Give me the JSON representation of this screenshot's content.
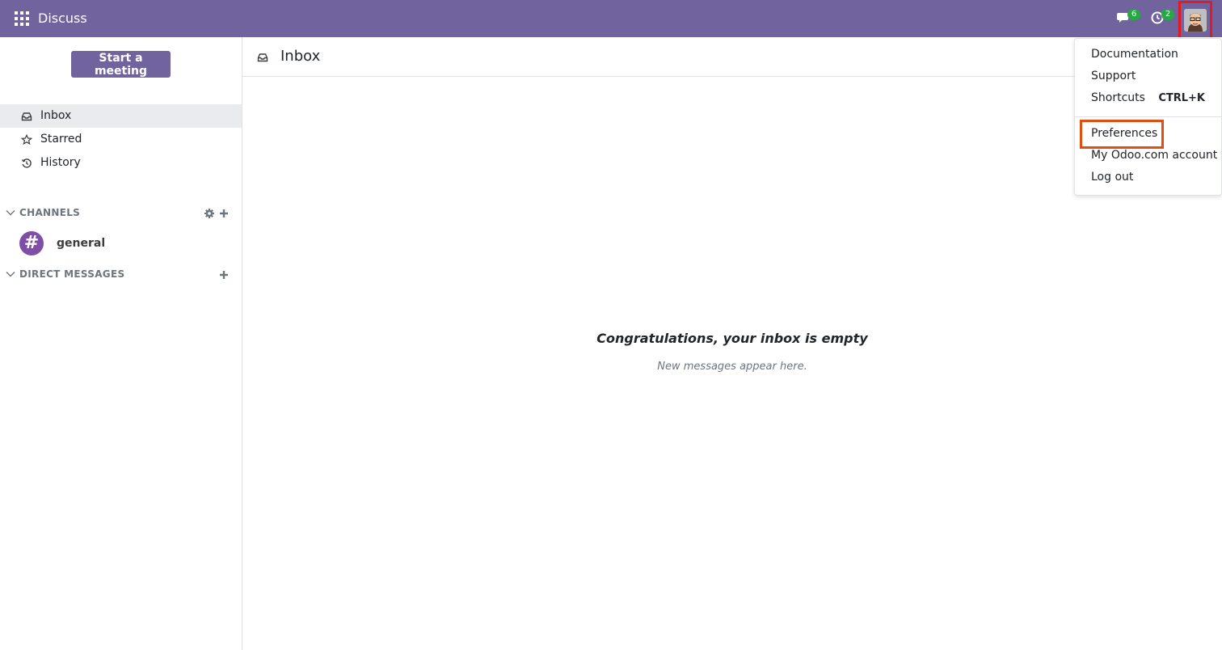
{
  "navbar": {
    "app_title": "Discuss",
    "messages_badge": "6",
    "activities_badge": "2",
    "accent": "#71639e"
  },
  "sidebar": {
    "start_meeting_label": "Start a meeting",
    "mailboxes": [
      {
        "label": "Inbox",
        "icon": "inbox-icon",
        "active": true
      },
      {
        "label": "Starred",
        "icon": "star-icon",
        "active": false
      },
      {
        "label": "History",
        "icon": "history-icon",
        "active": false
      }
    ],
    "channels_header": "CHANNELS",
    "channels": [
      {
        "name": "general",
        "avatar_glyph": "#"
      }
    ],
    "direct_messages_header": "DIRECT MESSAGES"
  },
  "main": {
    "title": "Inbox",
    "empty_title": "Congratulations, your inbox is empty",
    "empty_subtitle": "New messages appear here."
  },
  "user_menu": {
    "items": [
      {
        "label": "Documentation"
      },
      {
        "label": "Support"
      },
      {
        "label": "Shortcuts",
        "shortcut": "CTRL+K"
      },
      {
        "label": "Preferences",
        "highlighted": true
      },
      {
        "label": "My Odoo.com account"
      },
      {
        "label": "Log out"
      }
    ]
  }
}
